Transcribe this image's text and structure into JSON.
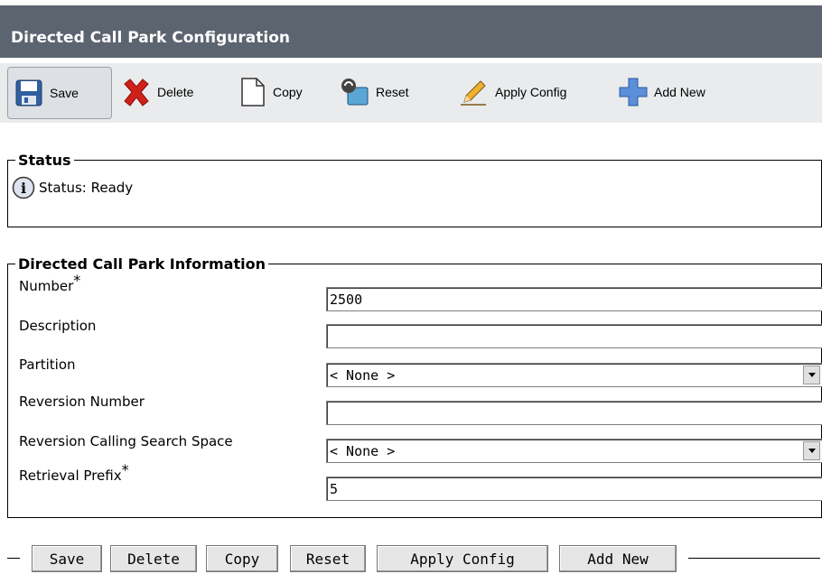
{
  "header": {
    "title": "Directed Call Park Configuration"
  },
  "toolbar": {
    "save": "Save",
    "delete": "Delete",
    "copy": "Copy",
    "reset": "Reset",
    "apply_config": "Apply Config",
    "add_new": "Add New"
  },
  "status": {
    "legend": "Status",
    "text": "Status: Ready"
  },
  "info": {
    "legend": "Directed Call Park Information",
    "fields": [
      {
        "label": "Number",
        "required": "*",
        "value": "2500",
        "type": "text"
      },
      {
        "label": "Description",
        "required": "",
        "value": "",
        "type": "text"
      },
      {
        "label": "Partition",
        "required": "",
        "value": "< None >",
        "type": "select"
      },
      {
        "label": "Reversion Number",
        "required": "",
        "value": "",
        "type": "text"
      },
      {
        "label": "Reversion Calling Search Space",
        "required": "",
        "value": "< None >",
        "type": "select"
      },
      {
        "label": "Retrieval Prefix",
        "required": "*",
        "value": "5",
        "type": "text"
      }
    ]
  },
  "bottom_buttons": {
    "save": "Save",
    "delete": "Delete",
    "copy": "Copy",
    "reset": "Reset",
    "apply_config": "Apply Config",
    "add_new": "Add New"
  },
  "colors": {
    "title_band": "#5c6470",
    "toolbar_bg": "#e9ebed",
    "delete_red": "#d0201a",
    "add_blue": "#5b8fd8"
  }
}
